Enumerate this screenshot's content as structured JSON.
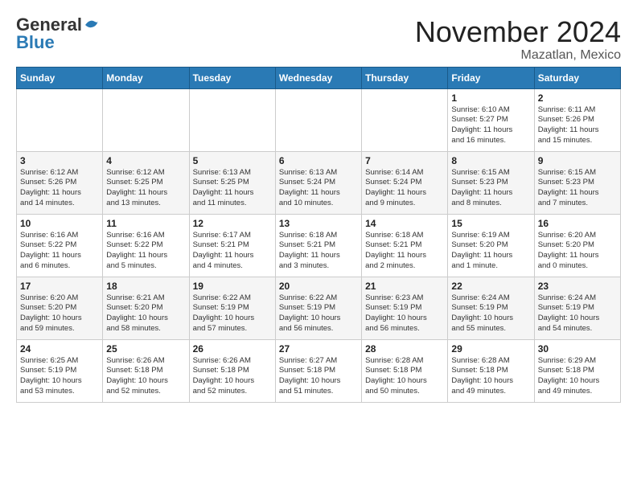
{
  "header": {
    "logo_general": "General",
    "logo_blue": "Blue",
    "month_year": "November 2024",
    "location": "Mazatlan, Mexico"
  },
  "days_of_week": [
    "Sunday",
    "Monday",
    "Tuesday",
    "Wednesday",
    "Thursday",
    "Friday",
    "Saturday"
  ],
  "weeks": [
    {
      "days": [
        {
          "num": "",
          "info": ""
        },
        {
          "num": "",
          "info": ""
        },
        {
          "num": "",
          "info": ""
        },
        {
          "num": "",
          "info": ""
        },
        {
          "num": "",
          "info": ""
        },
        {
          "num": "1",
          "info": "Sunrise: 6:10 AM\nSunset: 5:27 PM\nDaylight: 11 hours\nand 16 minutes."
        },
        {
          "num": "2",
          "info": "Sunrise: 6:11 AM\nSunset: 5:26 PM\nDaylight: 11 hours\nand 15 minutes."
        }
      ]
    },
    {
      "days": [
        {
          "num": "3",
          "info": "Sunrise: 6:12 AM\nSunset: 5:26 PM\nDaylight: 11 hours\nand 14 minutes."
        },
        {
          "num": "4",
          "info": "Sunrise: 6:12 AM\nSunset: 5:25 PM\nDaylight: 11 hours\nand 13 minutes."
        },
        {
          "num": "5",
          "info": "Sunrise: 6:13 AM\nSunset: 5:25 PM\nDaylight: 11 hours\nand 11 minutes."
        },
        {
          "num": "6",
          "info": "Sunrise: 6:13 AM\nSunset: 5:24 PM\nDaylight: 11 hours\nand 10 minutes."
        },
        {
          "num": "7",
          "info": "Sunrise: 6:14 AM\nSunset: 5:24 PM\nDaylight: 11 hours\nand 9 minutes."
        },
        {
          "num": "8",
          "info": "Sunrise: 6:15 AM\nSunset: 5:23 PM\nDaylight: 11 hours\nand 8 minutes."
        },
        {
          "num": "9",
          "info": "Sunrise: 6:15 AM\nSunset: 5:23 PM\nDaylight: 11 hours\nand 7 minutes."
        }
      ]
    },
    {
      "days": [
        {
          "num": "10",
          "info": "Sunrise: 6:16 AM\nSunset: 5:22 PM\nDaylight: 11 hours\nand 6 minutes."
        },
        {
          "num": "11",
          "info": "Sunrise: 6:16 AM\nSunset: 5:22 PM\nDaylight: 11 hours\nand 5 minutes."
        },
        {
          "num": "12",
          "info": "Sunrise: 6:17 AM\nSunset: 5:21 PM\nDaylight: 11 hours\nand 4 minutes."
        },
        {
          "num": "13",
          "info": "Sunrise: 6:18 AM\nSunset: 5:21 PM\nDaylight: 11 hours\nand 3 minutes."
        },
        {
          "num": "14",
          "info": "Sunrise: 6:18 AM\nSunset: 5:21 PM\nDaylight: 11 hours\nand 2 minutes."
        },
        {
          "num": "15",
          "info": "Sunrise: 6:19 AM\nSunset: 5:20 PM\nDaylight: 11 hours\nand 1 minute."
        },
        {
          "num": "16",
          "info": "Sunrise: 6:20 AM\nSunset: 5:20 PM\nDaylight: 11 hours\nand 0 minutes."
        }
      ]
    },
    {
      "days": [
        {
          "num": "17",
          "info": "Sunrise: 6:20 AM\nSunset: 5:20 PM\nDaylight: 10 hours\nand 59 minutes."
        },
        {
          "num": "18",
          "info": "Sunrise: 6:21 AM\nSunset: 5:20 PM\nDaylight: 10 hours\nand 58 minutes."
        },
        {
          "num": "19",
          "info": "Sunrise: 6:22 AM\nSunset: 5:19 PM\nDaylight: 10 hours\nand 57 minutes."
        },
        {
          "num": "20",
          "info": "Sunrise: 6:22 AM\nSunset: 5:19 PM\nDaylight: 10 hours\nand 56 minutes."
        },
        {
          "num": "21",
          "info": "Sunrise: 6:23 AM\nSunset: 5:19 PM\nDaylight: 10 hours\nand 56 minutes."
        },
        {
          "num": "22",
          "info": "Sunrise: 6:24 AM\nSunset: 5:19 PM\nDaylight: 10 hours\nand 55 minutes."
        },
        {
          "num": "23",
          "info": "Sunrise: 6:24 AM\nSunset: 5:19 PM\nDaylight: 10 hours\nand 54 minutes."
        }
      ]
    },
    {
      "days": [
        {
          "num": "24",
          "info": "Sunrise: 6:25 AM\nSunset: 5:19 PM\nDaylight: 10 hours\nand 53 minutes."
        },
        {
          "num": "25",
          "info": "Sunrise: 6:26 AM\nSunset: 5:18 PM\nDaylight: 10 hours\nand 52 minutes."
        },
        {
          "num": "26",
          "info": "Sunrise: 6:26 AM\nSunset: 5:18 PM\nDaylight: 10 hours\nand 52 minutes."
        },
        {
          "num": "27",
          "info": "Sunrise: 6:27 AM\nSunset: 5:18 PM\nDaylight: 10 hours\nand 51 minutes."
        },
        {
          "num": "28",
          "info": "Sunrise: 6:28 AM\nSunset: 5:18 PM\nDaylight: 10 hours\nand 50 minutes."
        },
        {
          "num": "29",
          "info": "Sunrise: 6:28 AM\nSunset: 5:18 PM\nDaylight: 10 hours\nand 49 minutes."
        },
        {
          "num": "30",
          "info": "Sunrise: 6:29 AM\nSunset: 5:18 PM\nDaylight: 10 hours\nand 49 minutes."
        }
      ]
    }
  ]
}
